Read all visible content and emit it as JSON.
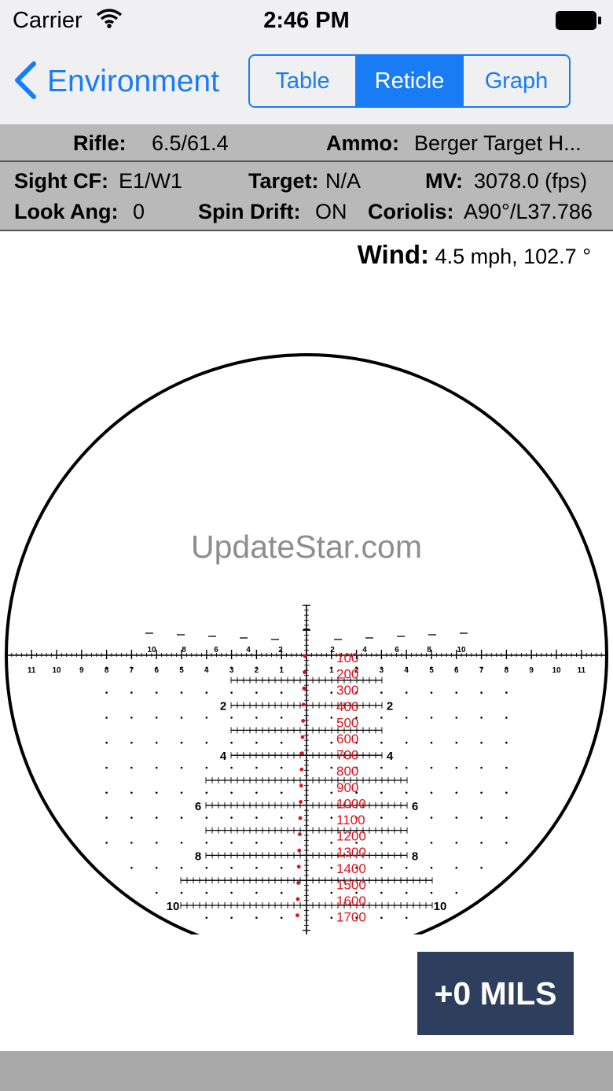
{
  "status": {
    "carrier": "Carrier",
    "time": "2:46 PM"
  },
  "nav": {
    "back_label": "Environment",
    "segments": [
      "Table",
      "Reticle",
      "Graph"
    ],
    "active_segment": "Reticle"
  },
  "info": {
    "rifle_label": "Rifle:",
    "rifle_value": "6.5/61.4",
    "ammo_label": "Ammo:",
    "ammo_value": "Berger Target H...",
    "sight_label": "Sight CF:",
    "sight_value": "E1/W1",
    "target_label": "Target:",
    "target_value": "N/A",
    "mv_label": "MV:",
    "mv_value": "3078.0 (fps)",
    "look_label": "Look Ang:",
    "look_value": "0",
    "spin_label": "Spin Drift:",
    "spin_value": "ON",
    "coriolis_label": "Coriolis:",
    "coriolis_value": "A90°/L37.786"
  },
  "wind": {
    "label": "Wind:",
    "value": "4.5 mph, 102.7 °"
  },
  "watermark": "UpdateStar.com",
  "reticle": {
    "horizontal_upper_labels": [
      "10",
      "8",
      "6",
      "4",
      "2",
      "2",
      "4",
      "6",
      "8",
      "10"
    ],
    "horizontal_lower_labels": [
      "11",
      "10",
      "9",
      "8",
      "7",
      "6",
      "5",
      "4",
      "3",
      "2",
      "1",
      "1",
      "2",
      "3",
      "4",
      "5",
      "6",
      "7",
      "8",
      "9",
      "10",
      "11"
    ],
    "vertical_side_labels": [
      "2",
      "4",
      "6",
      "8",
      "10"
    ],
    "range_labels": [
      "100",
      "200",
      "300",
      "400",
      "500",
      "600",
      "700",
      "800",
      "900",
      "1000",
      "1100",
      "1200",
      "1300",
      "1400",
      "1500",
      "1600",
      "1700"
    ]
  },
  "adjustment_button": "+0 MILS",
  "colors": {
    "accent": "#1a7cf5",
    "info_bg": "#b9b9b9",
    "range_red": "#e0101a",
    "mils_bg": "#2e3f5e"
  }
}
